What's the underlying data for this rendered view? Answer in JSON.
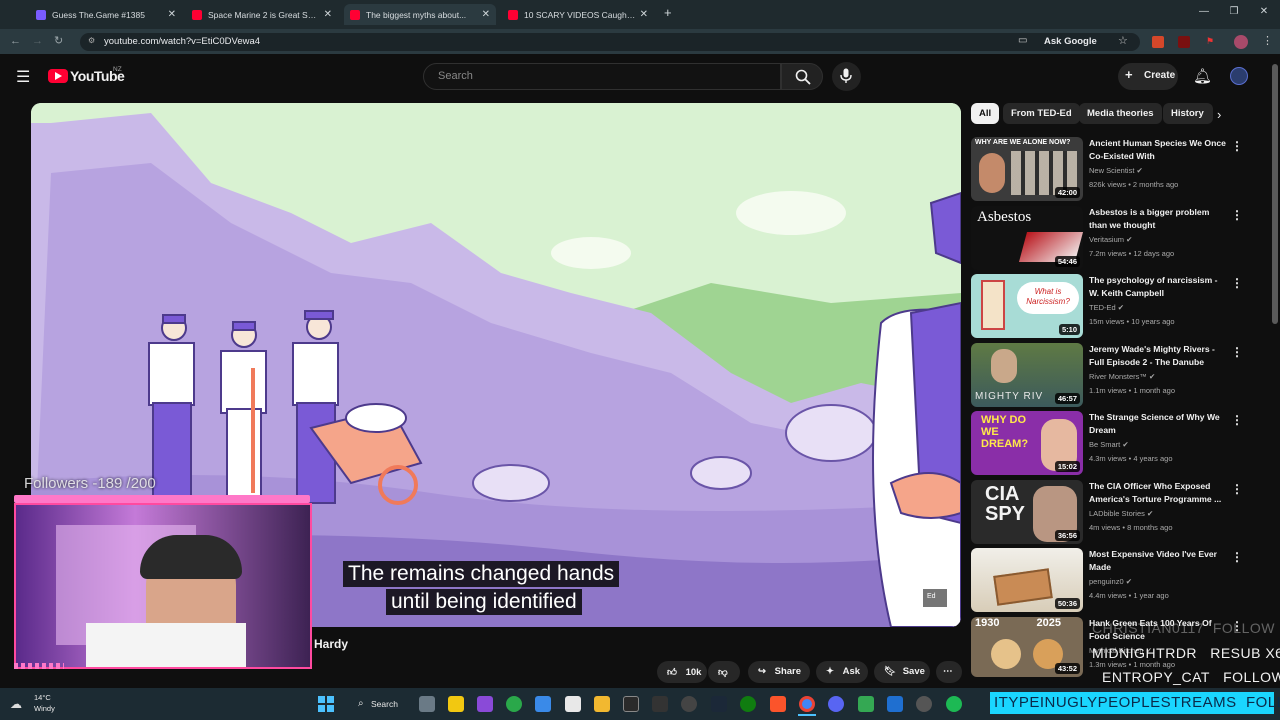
{
  "browser": {
    "tabs": [
      {
        "title": "Guess The.Game #1385",
        "favicon_color": "#7a5cff"
      },
      {
        "title": "Space Marine 2 is Great So Far...",
        "favicon_color": "#ff0033"
      },
      {
        "title": "The biggest myths about...",
        "favicon_color": "#ff0033"
      },
      {
        "title": "10 SCARY VIDEOS Caught On C...",
        "favicon_color": "#ff0033"
      }
    ],
    "new_tab_label": "+",
    "url": "youtube.com/watch?v=EtiC0DVewa4",
    "ask_google_label": "Ask Google"
  },
  "youtube": {
    "logo_text": "YouTube",
    "region": "NZ",
    "search_placeholder": "Search",
    "create_label": "Create",
    "chips": [
      "All",
      "From TED-Ed",
      "Media theories",
      "History"
    ],
    "selected_chip": "All"
  },
  "video": {
    "caption_line1": "The remains changed hands",
    "caption_line2": "until being identified",
    "channel_partial": "Hardy",
    "watermark": "Ed",
    "actions": {
      "likes": "10k",
      "share": "Share",
      "ask": "Ask",
      "save": "Save"
    }
  },
  "recommendations": [
    {
      "title": "Ancient Human Species We Once Co-Existed With",
      "channel": "New Scientist",
      "views": "826k views",
      "age": "2 months ago",
      "duration": "42:00",
      "thumb_text": "WHY ARE WE ALONE NOW?",
      "thumb_color": "#3b3b3b"
    },
    {
      "title": "Asbestos is a bigger problem than we thought",
      "channel": "Veritasium",
      "views": "7.2m views",
      "age": "12 days ago",
      "duration": "54:46",
      "thumb_text": "Asbestos",
      "thumb_color": "#b8141b"
    },
    {
      "title": "The psychology of narcissism - W. Keith Campbell",
      "channel": "TED-Ed",
      "views": "15m views",
      "age": "10 years ago",
      "duration": "5:10",
      "thumb_text": "What is Narcissism?",
      "thumb_color": "#a8dcd6"
    },
    {
      "title": "Jeremy Wade's Mighty Rivers - Full Episode 2 - The Danube",
      "channel": "River Monsters™",
      "views": "1.1m views",
      "age": "1 month ago",
      "duration": "46:57",
      "thumb_text": "MIGHTY RIV",
      "thumb_color": "#4f6a3c"
    },
    {
      "title": "The Strange Science of Why We Dream",
      "channel": "Be Smart",
      "views": "4.3m views",
      "age": "4 years ago",
      "duration": "15:02",
      "thumb_text": "WHY DO WE DREAM?",
      "thumb_color": "#8a2ea8"
    },
    {
      "title": "The CIA Officer Who Exposed America's Torture Programme ...",
      "channel": "LADbible Stories",
      "views": "4m views",
      "age": "8 months ago",
      "duration": "36:56",
      "thumb_text": "CIA SPY",
      "thumb_color": "#2a2a2a"
    },
    {
      "title": "Most Expensive Video I've Ever Made",
      "channel": "penguinz0",
      "views": "4.4m views",
      "age": "1 year ago",
      "duration": "50:36",
      "thumb_text": "",
      "thumb_color": "#c98b55"
    },
    {
      "title": "Hank Green Eats 100 Years Of Food Science",
      "channel": "Mythical Kitchen",
      "views": "1.3m views",
      "age": "1 month ago",
      "duration": "43:52",
      "thumb_text": "1930 2025",
      "thumb_color": "#7a6a55"
    }
  ],
  "stream_overlay": {
    "followers_goal": "Followers -189 /200",
    "alerts": [
      {
        "name": "CHRISTIAN0117",
        "action": "FOLLOW"
      },
      {
        "name": "MIDNIGHTRDR",
        "action": "RESUB X6"
      },
      {
        "name": "ENTROPY_CAT",
        "action": "FOLLOW"
      },
      {
        "name": "ITYPEINUGLYPEOPLESTREAMS",
        "action": "FOLLOW"
      }
    ]
  },
  "taskbar": {
    "weather_temp": "14°C",
    "weather_desc": "Windy",
    "search_label": "Search"
  }
}
